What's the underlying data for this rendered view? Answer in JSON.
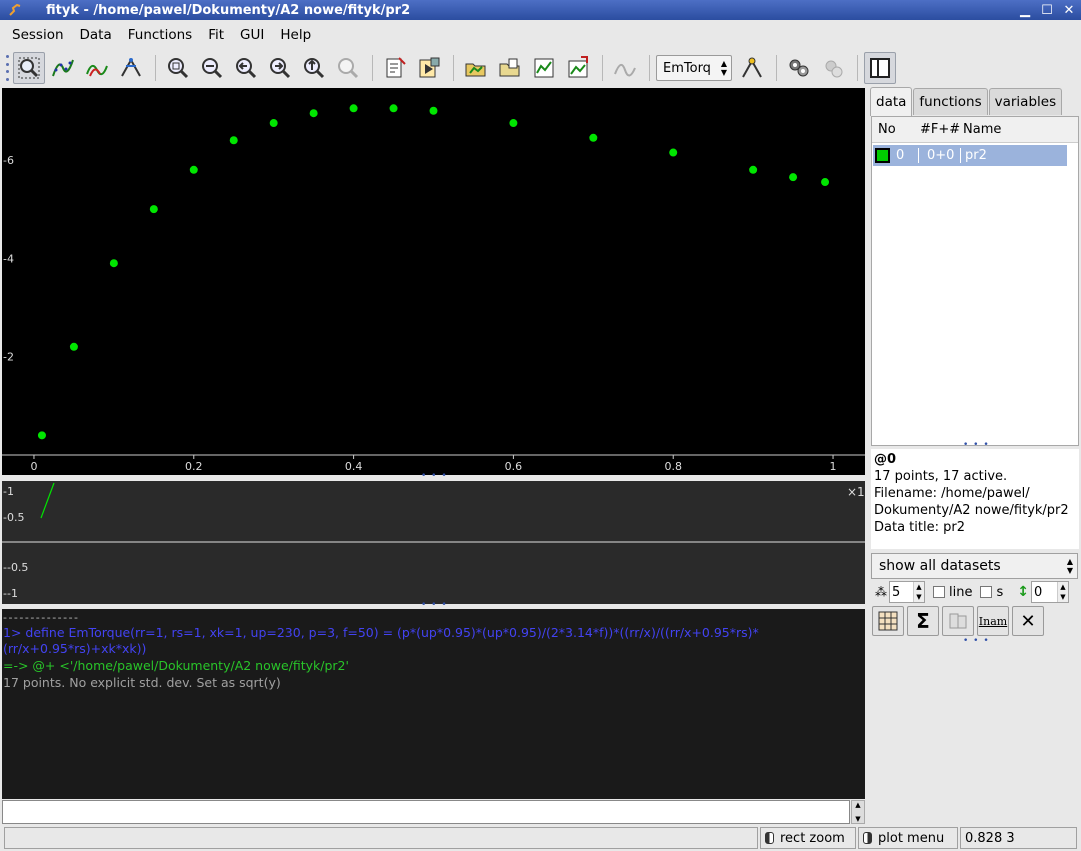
{
  "window": {
    "title": "fityk - /home/pawel/Dokumenty/A2 nowe/fityk/pr2",
    "minimize_glyph": "▁",
    "maximize_glyph": "☐",
    "close_glyph": "✕"
  },
  "menu": {
    "items": [
      "Session",
      "Data",
      "Functions",
      "Fit",
      "GUI",
      "Help"
    ]
  },
  "toolbar": {
    "function_combo": "EmTorq",
    "icons": [
      "zoom-rect-icon",
      "add-data-icon",
      "add-peak-icon",
      "move-peak-icon",
      "zoom-all-icon",
      "zoom-vertical-icon",
      "zoom-prev-icon",
      "zoom-next-icon",
      "zoom-fit-icon",
      "zoom-back-icon",
      "edit-script-icon",
      "run-script-icon",
      "open-data-icon",
      "open-session-icon",
      "plot-data-icon",
      "export-plot-icon",
      "peak-find-icon",
      "guess-peak-icon",
      "start-fit-icon",
      "undo-fit-icon",
      "sidebar-toggle-icon"
    ]
  },
  "main_plot": {
    "background": "#000000",
    "point_color": "#00e600",
    "x_ticks": [
      "0",
      "0.2",
      "0.4",
      "0.6",
      "0.8",
      "1"
    ],
    "y_ticks": [
      "-2",
      "-4",
      "-6"
    ]
  },
  "chart_data": {
    "type": "scatter",
    "x": [
      0.01,
      0.05,
      0.1,
      0.15,
      0.2,
      0.25,
      0.3,
      0.35,
      0.4,
      0.45,
      0.5,
      0.6,
      0.7,
      0.8,
      0.9,
      0.95,
      0.99
    ],
    "y": [
      0.4,
      2.2,
      3.9,
      5.0,
      5.8,
      6.4,
      6.75,
      6.95,
      7.05,
      7.05,
      7.0,
      6.75,
      6.45,
      6.15,
      5.8,
      5.65,
      5.55
    ],
    "xlim": [
      -0.04,
      1.04
    ],
    "ylim": [
      0,
      7.3
    ],
    "grid": false,
    "series": [
      {
        "values": [
          0.4,
          2.2,
          3.9,
          5.0,
          5.8,
          6.4,
          6.75,
          6.95,
          7.05,
          7.05,
          7.0,
          6.75,
          6.45,
          6.15,
          5.8,
          5.65,
          5.55
        ]
      }
    ]
  },
  "aux_plot": {
    "y_ticks_top": [
      "-1",
      "-0.5"
    ],
    "y_ticks_bottom": [
      "--0.5",
      "--1"
    ],
    "scale_label": "×1"
  },
  "console": {
    "separator": "- - - - - - - - - - - - - -",
    "lines": [
      {
        "kind": "cmd",
        "text": "1> define EmTorque(rr=1, rs=1, xk=1, up=230, p=3, f=50) = (p*(up*0.95)*(up*0.95)/(2*3.14*f))*((rr/x)/((rr/x+0.95*rs)*(rr/x+0.95*rs)+xk*xk))"
      },
      {
        "kind": "info",
        "text": "=-> @+ <'/home/pawel/Dokumenty/A2 nowe/fityk/pr2'"
      },
      {
        "kind": "normal",
        "text": "17 points. No explicit std. dev. Set as sqrt(y)"
      }
    ],
    "input_value": ""
  },
  "status": {
    "text": "",
    "mode_label": "rect zoom",
    "menu_label": "plot menu",
    "coords": "0.828  3"
  },
  "sidebar": {
    "tabs": [
      "data",
      "functions",
      "variables"
    ],
    "columns": [
      "No",
      "#F+#",
      "Name"
    ],
    "rows": [
      {
        "no": "0",
        "f": "0+0",
        "name": "pr2",
        "color": "#00cc00"
      }
    ],
    "info": {
      "id": "@0",
      "points": "17 points, 17 active.",
      "filename_line1": "Filename: /home/pawel/",
      "filename_line2": "Dokumenty/A2 nowe/fityk/pr2",
      "data_title": "Data title: pr2"
    },
    "dataset_select": "show all datasets",
    "point_size": "5",
    "line_label": "line",
    "s_label": "s",
    "shift_value": "0"
  }
}
